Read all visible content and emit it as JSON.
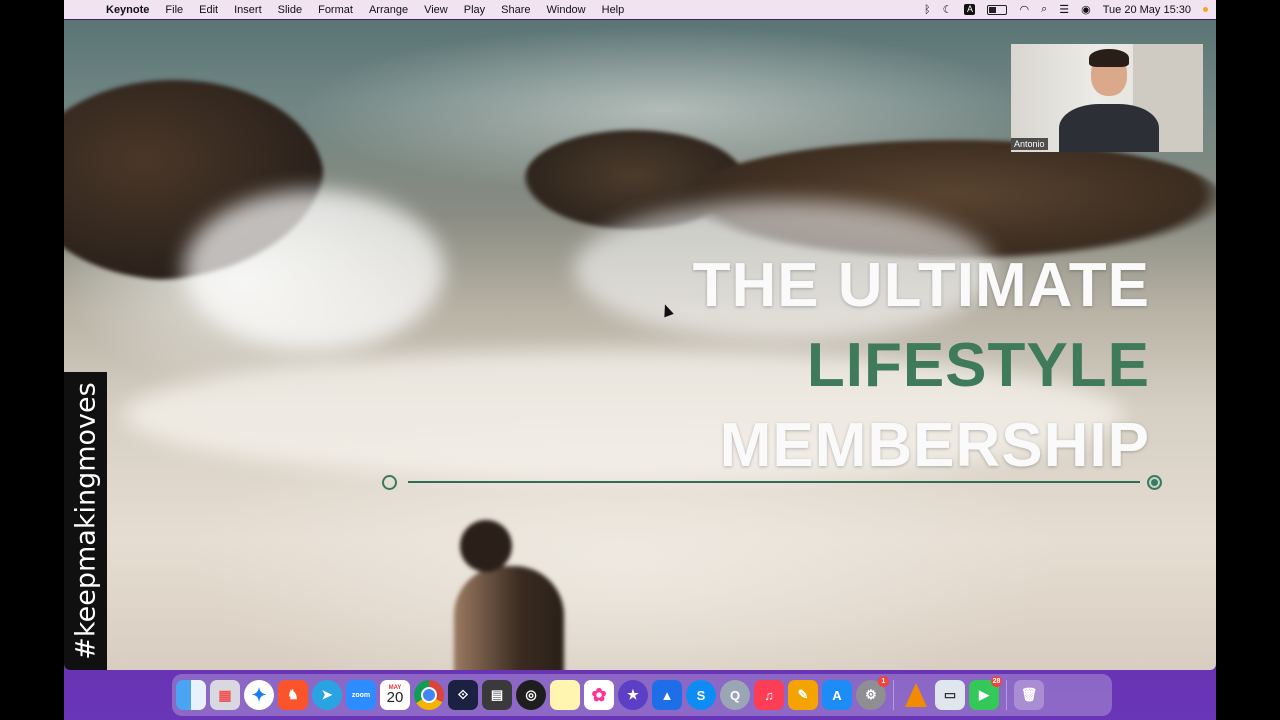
{
  "menubar": {
    "app_name": "Keynote",
    "menus": [
      "File",
      "Edit",
      "Insert",
      "Slide",
      "Format",
      "Arrange",
      "View",
      "Play",
      "Share",
      "Window",
      "Help"
    ],
    "input_source": "A",
    "datetime": "Tue 20 May  15:30"
  },
  "slide": {
    "title_line1": "THE ULTIMATE",
    "title_line2": "LIFESTYLE",
    "title_line3": "MEMBERSHIP",
    "hashtag": "#keepmakingmoves",
    "accent_color": "#3f7a5a"
  },
  "video_overlay": {
    "participant_name": "Antonio"
  },
  "dock": {
    "items": [
      {
        "name": "finder",
        "label": ""
      },
      {
        "name": "launchpad",
        "label": ""
      },
      {
        "name": "safari",
        "label": ""
      },
      {
        "name": "brave",
        "label": ""
      },
      {
        "name": "telegram",
        "label": ""
      },
      {
        "name": "zoom",
        "label": "zoom"
      },
      {
        "name": "calendar",
        "label": "20",
        "month": "MAY"
      },
      {
        "name": "chrome",
        "label": ""
      },
      {
        "name": "vpn-app",
        "label": ""
      },
      {
        "name": "calculator",
        "label": ""
      },
      {
        "name": "obs",
        "label": ""
      },
      {
        "name": "notes",
        "label": ""
      },
      {
        "name": "photos",
        "label": ""
      },
      {
        "name": "imovie",
        "label": ""
      },
      {
        "name": "keynote",
        "label": ""
      },
      {
        "name": "shazam",
        "label": ""
      },
      {
        "name": "quicktime",
        "label": ""
      },
      {
        "name": "music",
        "label": ""
      },
      {
        "name": "pages",
        "label": ""
      },
      {
        "name": "app-store",
        "label": ""
      },
      {
        "name": "system-preferences",
        "label": "",
        "badge": "1"
      },
      {
        "name": "vlc",
        "label": ""
      },
      {
        "name": "preview",
        "label": ""
      },
      {
        "name": "facetime",
        "label": "",
        "badge": "28"
      },
      {
        "name": "trash",
        "label": ""
      }
    ]
  }
}
